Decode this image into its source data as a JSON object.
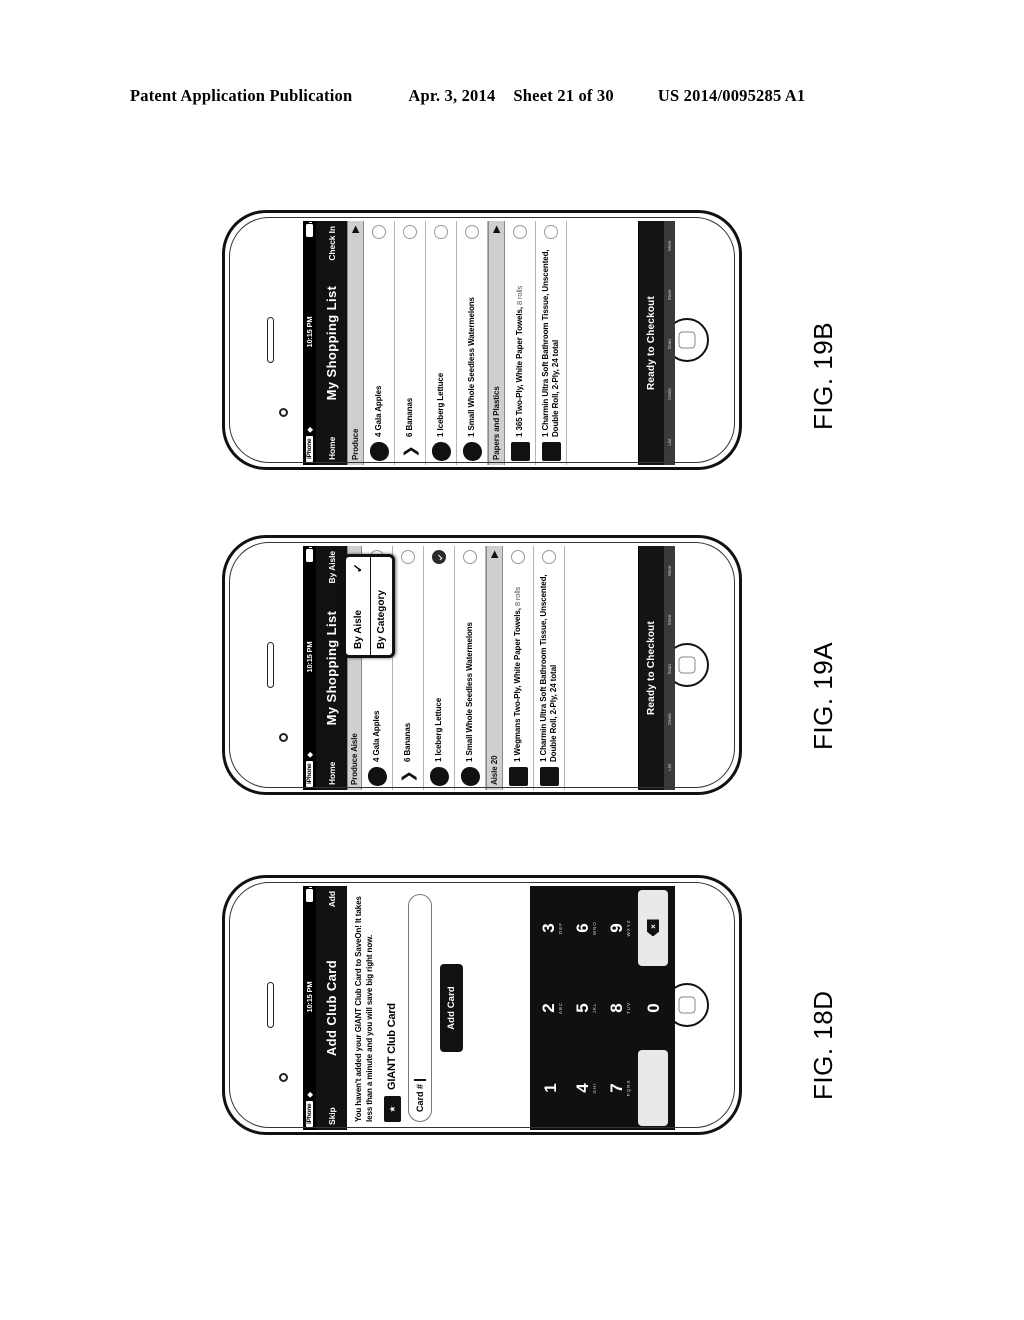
{
  "patent_header": {
    "publication": "Patent Application Publication",
    "date": "Apr. 3, 2014",
    "sheet": "Sheet 21 of 30",
    "number": "US 2014/0095285 A1"
  },
  "figures": [
    {
      "id": "fig-19b",
      "caption": "FIG. 19B",
      "status_bar": {
        "carrier": "iPhone",
        "wifi_icon": "wifi-icon",
        "time": "10:15 PM",
        "battery_icon": "battery-icon"
      },
      "nav": {
        "left_button": "Home",
        "title": "My Shopping List",
        "right_button": "Check In"
      },
      "sections": [
        {
          "header": "Produce",
          "header_arrow": "▶",
          "items": [
            {
              "text": "4 Gala Apples",
              "sub": "",
              "thumb": "apple-thumb",
              "accessory": "circle-check-empty"
            },
            {
              "text": "6 Bananas",
              "sub": "",
              "thumb": "banana-thumb",
              "accessory": "circle-check-empty"
            },
            {
              "text": "1 Iceberg Lettuce",
              "sub": "",
              "thumb": "lettuce-thumb",
              "accessory": "circle-check-empty"
            },
            {
              "text": "1 Small Whole Seedless Watermelons",
              "sub": "",
              "thumb": "watermelon-thumb",
              "accessory": "circle-check-empty"
            }
          ]
        },
        {
          "header": "Papers and Plastics",
          "header_arrow": "▶",
          "items": [
            {
              "text": "1 365 Two-Ply, White Paper Towels,",
              "sub": " 8 rolls",
              "thumb": "paper-towels-thumb",
              "accessory": "circle-check-empty"
            },
            {
              "text": "1 Charmin Ultra Soft Bathroom Tissue, Unscented, Double Roll, 2-Ply, 24 total",
              "sub": "",
              "thumb": "tissue-thumb",
              "accessory": "circle-check-empty"
            }
          ]
        }
      ],
      "cta_label": "Ready to Checkout",
      "tabbar": [
        "List",
        "Deals",
        "Scan",
        "Store",
        "More"
      ],
      "popover": null
    },
    {
      "id": "fig-19a",
      "caption": "FIG. 19A",
      "status_bar": {
        "carrier": "iPhone",
        "wifi_icon": "wifi-icon",
        "time": "10:15 PM",
        "battery_icon": "battery-icon"
      },
      "nav": {
        "left_button": "Home",
        "title": "My Shopping List",
        "right_button": "By Aisle"
      },
      "sections": [
        {
          "header": "Produce Aisle",
          "header_arrow": "",
          "items": [
            {
              "text": "4 Gala Apples",
              "sub": "",
              "thumb": "apple-thumb",
              "accessory": "circle-check-empty"
            },
            {
              "text": "6 Bananas",
              "sub": "",
              "thumb": "banana-thumb",
              "accessory": "circle-check-empty"
            },
            {
              "text": "1 Iceberg Lettuce",
              "sub": "",
              "thumb": "lettuce-thumb",
              "accessory": "circle-check-filled"
            },
            {
              "text": "1 Small Whole Seedless Watermelons",
              "sub": "",
              "thumb": "watermelon-thumb",
              "accessory": "circle-check-empty"
            }
          ]
        },
        {
          "header": "Aisle 20",
          "header_arrow": "▶",
          "items": [
            {
              "text": "1 Wegmans Two-Ply, White Paper Towels,",
              "sub": " 8 rolls",
              "thumb": "paper-towels-thumb",
              "accessory": "circle-check-empty"
            },
            {
              "text": "1 Charmin Ultra Soft Bathroom Tissue, Unscented, Double Roll, 2-Ply, 24 total",
              "sub": "",
              "thumb": "tissue-thumb",
              "accessory": "circle-check-empty"
            }
          ]
        }
      ],
      "cta_label": "Ready to Checkout",
      "tabbar": [
        "List",
        "Deals",
        "Scan",
        "Store",
        "More"
      ],
      "popover": {
        "options": [
          {
            "label": "By Aisle",
            "checked": true,
            "check_icon": "checkmark-icon"
          },
          {
            "label": "By Category",
            "checked": false,
            "check_icon": ""
          }
        ]
      }
    }
  ],
  "club_card_figure": {
    "id": "fig-18d",
    "caption": "FIG. 18D",
    "status_bar": {
      "carrier": "iPhone",
      "wifi_icon": "wifi-icon",
      "time": "10:15 PM",
      "battery_icon": "battery-icon"
    },
    "nav": {
      "left_button": "Skip",
      "title": "Add Club Card",
      "right_button": "Add"
    },
    "paragraph": "You haven't added your GIANT Club Card to SaveOn! It takes less than a minute and you will save big right now.",
    "card_icon": "club-card-icon",
    "brand_name": "GIANT Club Card",
    "field": {
      "label": "Card #",
      "value": "",
      "caret": true
    },
    "add_card_button": "Add Card",
    "keypad": {
      "keys": [
        {
          "num": "1",
          "sub": ""
        },
        {
          "num": "2",
          "sub": "ABC"
        },
        {
          "num": "3",
          "sub": "DEF"
        },
        {
          "num": "4",
          "sub": "GHI"
        },
        {
          "num": "5",
          "sub": "JKL"
        },
        {
          "num": "6",
          "sub": "MNO"
        },
        {
          "num": "7",
          "sub": "PQRS"
        },
        {
          "num": "8",
          "sub": "TUV"
        },
        {
          "num": "9",
          "sub": "WXYZ"
        }
      ],
      "zero": "0",
      "delete_icon": "backspace-delete-icon",
      "delete_glyph": "×"
    }
  },
  "colors": {
    "ink": "#000000",
    "paper": "#ffffff",
    "chrome_dark": "#111111",
    "section_gray": "#cfcfcf"
  }
}
